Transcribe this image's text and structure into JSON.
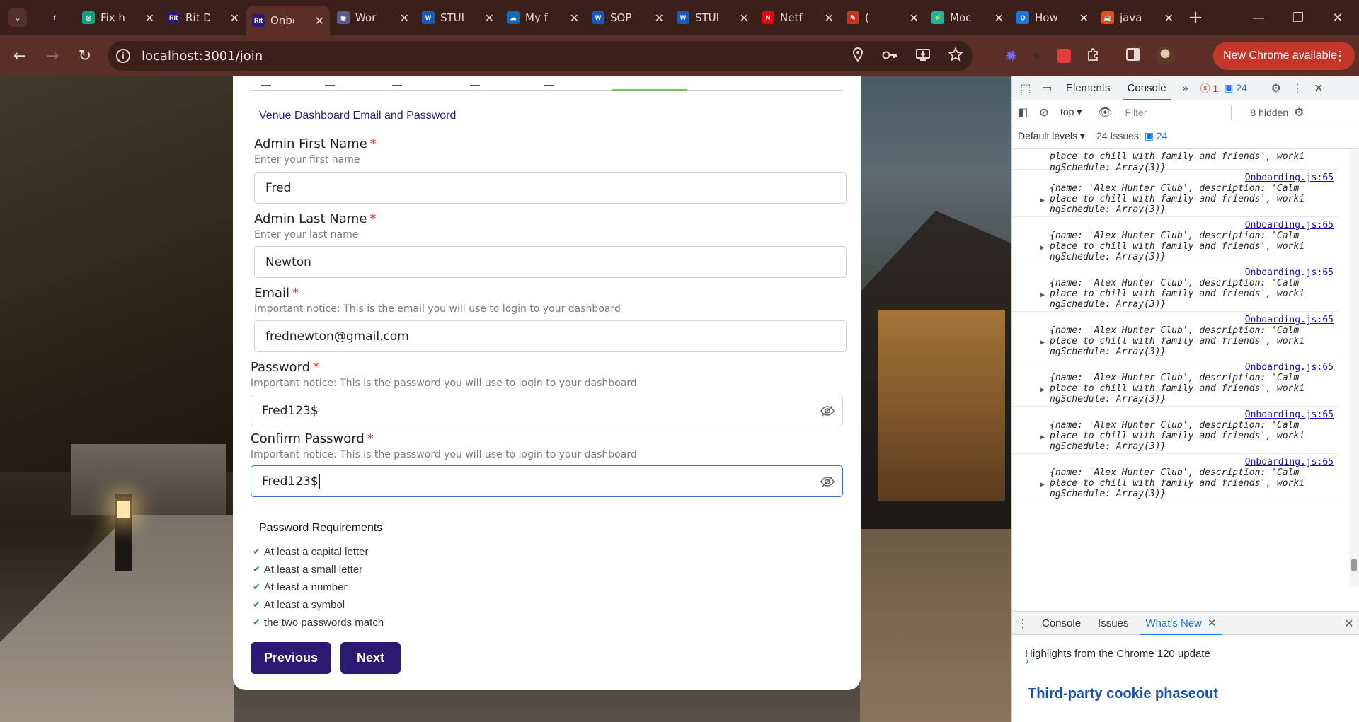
{
  "browser": {
    "tabs": [
      {
        "title": "",
        "favicon_color": "#3b1f19",
        "favicon_glyph": "f",
        "icon": "feather-icon"
      },
      {
        "title": "Fix h",
        "favicon_color": "#10a37f",
        "favicon_glyph": "◎",
        "icon": "chatgpt-icon"
      },
      {
        "title": "Rit D",
        "favicon_color": "#2c1a72",
        "favicon_glyph": "Rit",
        "icon": "rit-icon"
      },
      {
        "title": "Onbo",
        "favicon_color": "#2c1a72",
        "favicon_glyph": "Rit",
        "icon": "rit-icon",
        "active": true
      },
      {
        "title": "Wor",
        "favicon_color": "#5b5b8f",
        "favicon_glyph": "◉",
        "icon": "wordpress-icon"
      },
      {
        "title": "STUI",
        "favicon_color": "#185abd",
        "favicon_glyph": "W",
        "icon": "word-icon"
      },
      {
        "title": "My f",
        "favicon_color": "#0f6cbd",
        "favicon_glyph": "☁",
        "icon": "onedrive-icon"
      },
      {
        "title": "SOP",
        "favicon_color": "#185abd",
        "favicon_glyph": "W",
        "icon": "word-icon"
      },
      {
        "title": "STUI",
        "favicon_color": "#185abd",
        "favicon_glyph": "W",
        "icon": "word-icon"
      },
      {
        "title": "Netf",
        "favicon_color": "#e50914",
        "favicon_glyph": "N",
        "icon": "netflix-icon"
      },
      {
        "title": "(",
        "favicon_color": "#c4352a",
        "favicon_glyph": "✎",
        "icon": "edit-icon"
      },
      {
        "title": "Moc",
        "favicon_color": "#1fb5a3",
        "favicon_glyph": "⚡",
        "icon": "bolt-icon"
      },
      {
        "title": "How",
        "favicon_color": "#1a73e8",
        "favicon_glyph": "Q",
        "icon": "search-engine-icon"
      },
      {
        "title": "java",
        "favicon_color": "#d9531e",
        "favicon_glyph": "☕",
        "icon": "java-icon"
      }
    ],
    "url": "localhost:3001/join",
    "update_button": "New Chrome available"
  },
  "form": {
    "section_title": "Venue Dashboard Email and Password",
    "first_name": {
      "label": "Admin First Name",
      "help": "Enter your first name",
      "value": "Fred"
    },
    "last_name": {
      "label": "Admin Last Name",
      "help": "Enter your last name",
      "value": "Newton"
    },
    "email": {
      "label": "Email",
      "help": "Important notice: This is the email you will use to login to your dashboard",
      "value": "frednewton@gmail.com"
    },
    "password": {
      "label": "Password",
      "help": "Important notice: This is the password you will use to login to your dashboard",
      "value": "Fred123$"
    },
    "confirm_password": {
      "label": "Confirm Password",
      "help": "Important notice: This is the password you will use to login to your dashboard",
      "value": "Fred123$"
    },
    "required_mark": "*",
    "requirements": {
      "title": "Password Requirements",
      "items": [
        "At least a capital letter",
        "At least a small letter",
        "At least a number",
        "At least a symbol",
        "the two passwords match"
      ]
    },
    "previous_button": "Previous",
    "next_button": "Next"
  },
  "devtools": {
    "tabs": [
      "Elements",
      "Console"
    ],
    "error_count": "1",
    "issue_count": "24",
    "context": "top",
    "filter_placeholder": "Filter",
    "hidden_count": "8 hidden",
    "levels": "Default levels",
    "issues_label": "24 Issues:",
    "issues_badge": "24",
    "log_partial": {
      "line1": "place to chill with family and friends', worki",
      "line2": "ngSchedule: Array(3)}"
    },
    "log_entries": [
      {
        "source": "Onboarding.js:65",
        "line1": "{name: 'Alex Hunter Club', description: 'Calm",
        "line2": "place to chill with family and friends', worki",
        "line3": "ngSchedule: Array(3)}"
      },
      {
        "source": "Onboarding.js:65",
        "line1": "{name: 'Alex Hunter Club', description: 'Calm",
        "line2": "place to chill with family and friends', worki",
        "line3": "ngSchedule: Array(3)}"
      },
      {
        "source": "Onboarding.js:65",
        "line1": "{name: 'Alex Hunter Club', description: 'Calm",
        "line2": "place to chill with family and friends', worki",
        "line3": "ngSchedule: Array(3)}"
      },
      {
        "source": "Onboarding.js:65",
        "line1": "{name: 'Alex Hunter Club', description: 'Calm",
        "line2": "place to chill with family and friends', worki",
        "line3": "ngSchedule: Array(3)}"
      },
      {
        "source": "Onboarding.js:65",
        "line1": "{name: 'Alex Hunter Club', description: 'Calm",
        "line2": "place to chill with family and friends', worki",
        "line3": "ngSchedule: Array(3)}"
      },
      {
        "source": "Onboarding.js:65",
        "line1": "{name: 'Alex Hunter Club', description: 'Calm",
        "line2": "place to chill with family and friends', worki",
        "line3": "ngSchedule: Array(3)}"
      },
      {
        "source": "Onboarding.js:65",
        "line1": "{name: 'Alex Hunter Club', description: 'Calm",
        "line2": "place to chill with family and friends', worki",
        "line3": "ngSchedule: Array(3)}"
      }
    ],
    "drawer_tabs": [
      "Console",
      "Issues",
      "What's New"
    ],
    "whats_new_highlight": "Highlights from the Chrome 120 update",
    "whats_new_heading": "Third-party cookie phaseout"
  }
}
